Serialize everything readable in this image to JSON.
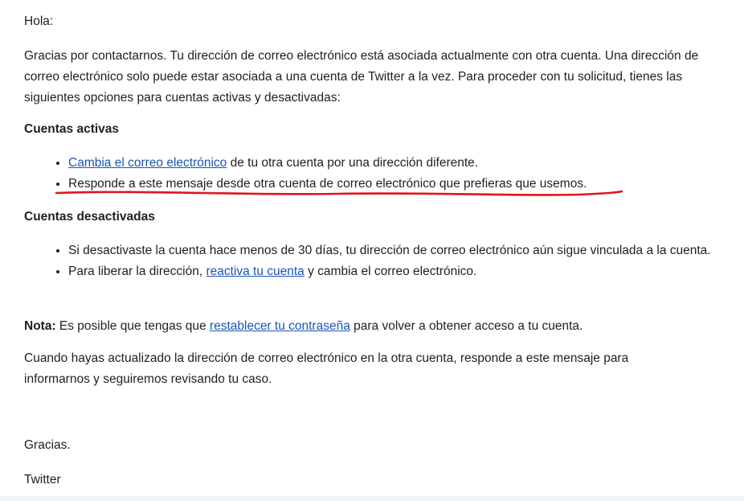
{
  "greeting": "Hola:",
  "intro": "Gracias por contactarnos. Tu dirección de correo electrónico está asociada actualmente con otra cuenta. Una dirección de correo electrónico solo puede estar asociada a una cuenta de Twitter a la vez. Para proceder con tu solicitud, tienes las siguientes opciones para cuentas activas y desactivadas:",
  "active": {
    "heading": "Cuentas activas",
    "items": [
      {
        "link": "Cambia el correo electrónico",
        "text": " de tu otra cuenta por una dirección diferente."
      },
      {
        "text": "Responde a este mensaje desde otra cuenta de correo electrónico que prefieras que usemos."
      }
    ]
  },
  "inactive": {
    "heading": "Cuentas desactivadas",
    "items": [
      {
        "text": "Si desactivaste la cuenta hace menos de 30 días, tu dirección de correo electrónico aún sigue vinculada a la cuenta."
      },
      {
        "pre": "Para liberar la dirección, ",
        "link": "reactiva tu cuenta",
        "text": " y cambia el correo electrónico."
      }
    ]
  },
  "note": {
    "label": "Nota:",
    "pre": " Es posible que tengas que ",
    "link": "restablecer tu contraseña",
    "post": " para volver a obtener acceso a tu cuenta."
  },
  "closing": "Cuando hayas actualizado la dirección de correo electrónico en la otra cuenta, responde a este mensaje para informarnos y seguiremos revisando tu caso.",
  "thanks": "Gracias.",
  "signature": "Twitter",
  "colors": {
    "link": "#1a55b8",
    "annotation": "#e0141e",
    "text": "#1f1f1f"
  }
}
